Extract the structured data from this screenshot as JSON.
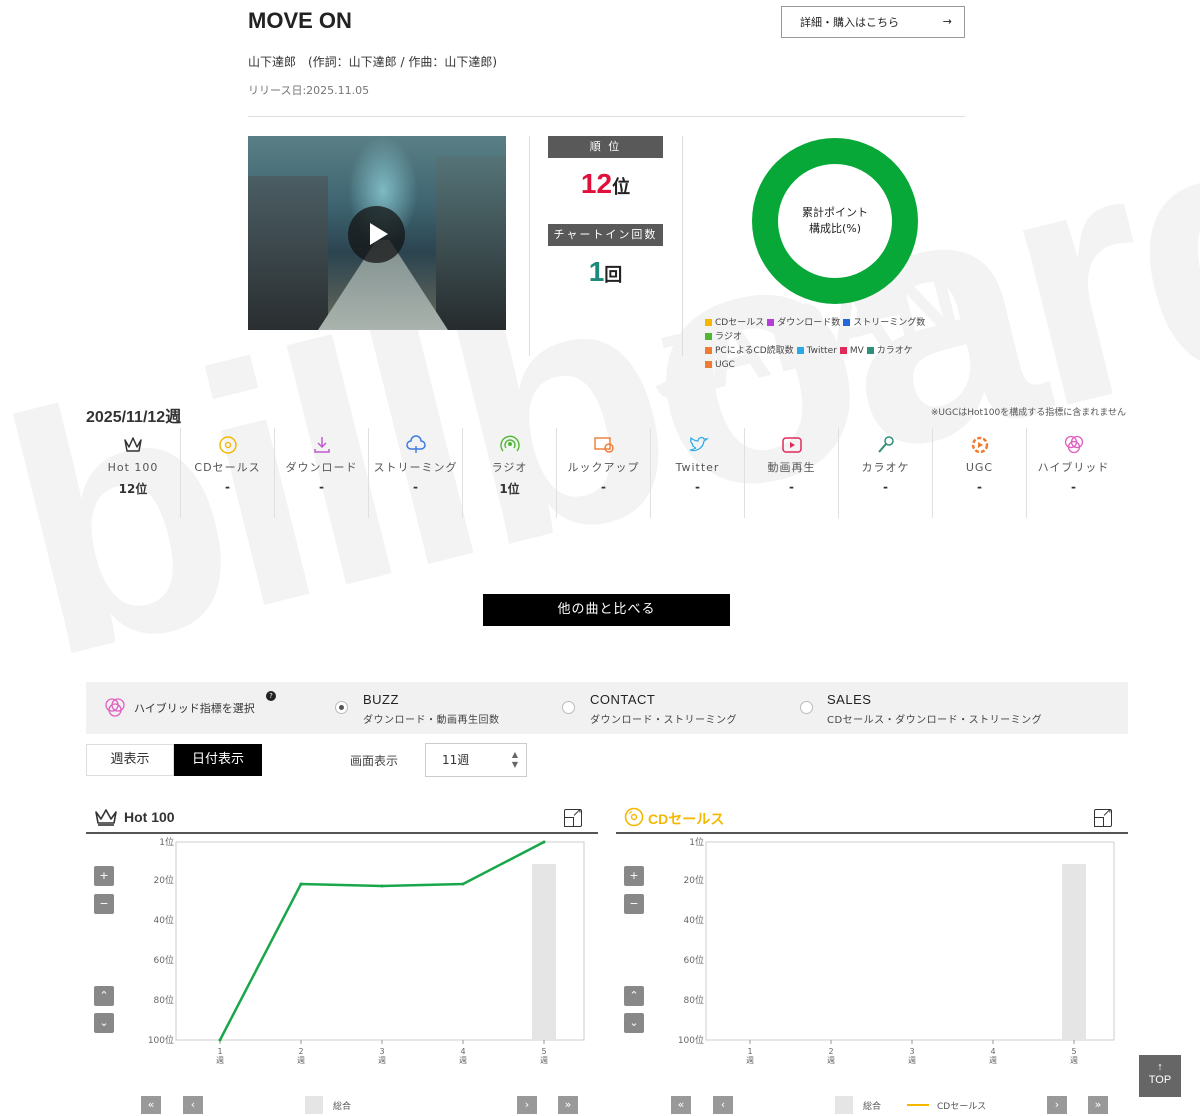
{
  "song": {
    "title": "MOVE ON",
    "artist_line": "山下達郎　(作詞：山下達郎 / 作曲：山下達郎)",
    "release": "リリース日:2025.11.05",
    "detail_button": "詳細・購入はこちら",
    "detail_arrow": "→"
  },
  "ranking": {
    "rank_label": "順 位",
    "rank_value": "12",
    "rank_unit": "位",
    "chartin_label": "チャートイン回数",
    "chartin_value": "1",
    "chartin_unit": "回"
  },
  "donut": {
    "label_line1": "累計ポイント",
    "label_line2": "構成比(%)",
    "ring_color": "#08a838",
    "legend": [
      {
        "label": "CDセールス",
        "color": "#f5b800"
      },
      {
        "label": "ダウンロード数",
        "color": "#b23fd6"
      },
      {
        "label": "ストリーミング数",
        "color": "#2266dd"
      },
      {
        "label": "ラジオ",
        "color": "#4cb832"
      },
      {
        "label": "PCによるCD読取数",
        "color": "#f07a30"
      },
      {
        "label": "Twitter",
        "color": "#2aa9e8"
      },
      {
        "label": "MV",
        "color": "#e02a5a"
      },
      {
        "label": "カラオケ",
        "color": "#2f8f7a"
      },
      {
        "label": "UGC",
        "color": "#f07a30"
      }
    ]
  },
  "week": {
    "title": "2025/11/12週",
    "ugc_note": "※UGCはHot100を構成する指標に含まれません",
    "metrics": [
      {
        "name": "Hot 100",
        "value": "12位",
        "icon": "crown-icon",
        "color": "#333333"
      },
      {
        "name": "CDセールス",
        "value": "-",
        "icon": "cd-icon",
        "color": "#f5b800"
      },
      {
        "name": "ダウンロード",
        "value": "-",
        "icon": "download-icon",
        "color": "#c05ad0"
      },
      {
        "name": "ストリーミング",
        "value": "-",
        "icon": "streaming-icon",
        "color": "#3d7be0"
      },
      {
        "name": "ラジオ",
        "value": "1位",
        "icon": "radio-icon",
        "color": "#4cb832"
      },
      {
        "name": "ルックアップ",
        "value": "-",
        "icon": "lookup-icon",
        "color": "#f07a30"
      },
      {
        "name": "Twitter",
        "value": "-",
        "icon": "twitter-icon",
        "color": "#2aa9e8"
      },
      {
        "name": "動画再生",
        "value": "-",
        "icon": "video-icon",
        "color": "#e02a5a"
      },
      {
        "name": "カラオケ",
        "value": "-",
        "icon": "karaoke-icon",
        "color": "#2f8f7a"
      },
      {
        "name": "UGC",
        "value": "-",
        "icon": "ugc-icon",
        "color": "#f07a30"
      },
      {
        "name": "ハイブリッド",
        "value": "-",
        "icon": "hybrid-icon",
        "color": "#e060c0"
      }
    ],
    "compare_button": "他の曲と比べる"
  },
  "hybrid": {
    "label": "ハイブリッド指標を選択",
    "help": "?",
    "options": [
      {
        "name": "BUZZ",
        "desc": "ダウンロード・動画再生回数",
        "selected": true
      },
      {
        "name": "CONTACT",
        "desc": "ダウンロード・ストリーミング",
        "selected": false
      },
      {
        "name": "SALES",
        "desc": "CDセールス・ダウンロード・ストリーミング",
        "selected": false
      }
    ]
  },
  "view": {
    "tab_week": "週表示",
    "tab_day": "日付表示",
    "display_label": "画面表示",
    "display_value": "11週",
    "up_arrow": "▲",
    "down_arrow": "▼"
  },
  "panels": [
    {
      "title": "Hot 100",
      "icon": "crown-icon",
      "title_color": "#333333",
      "legend_total": "総合",
      "legend_series": ""
    },
    {
      "title": "CDセールス",
      "icon": "cd-icon",
      "title_color": "#f5b800",
      "legend_total": "総合",
      "legend_series": "CDセールス"
    }
  ],
  "controls": {
    "zoom_in": "+",
    "zoom_out": "−",
    "up": "⌃",
    "down": "⌄",
    "first": "«",
    "prev": "‹",
    "next": "›",
    "last": "»"
  },
  "chart_data": [
    {
      "type": "line",
      "title": "Hot 100",
      "categories": [
        "1週",
        "2週",
        "3週",
        "4週",
        "5週"
      ],
      "y_ticks": [
        "1位",
        "20位",
        "40位",
        "60位",
        "80位",
        "100位"
      ],
      "ylim": [
        1,
        100
      ],
      "y_inverted": true,
      "series": [
        {
          "name": "",
          "color": "#1aa64a",
          "values": [
            100,
            22,
            23,
            22,
            1
          ]
        }
      ],
      "total_bar": {
        "name": "総合",
        "category": "5週",
        "value": 12
      }
    },
    {
      "type": "line",
      "title": "CDセールス",
      "categories": [
        "1週",
        "2週",
        "3週",
        "4週",
        "5週"
      ],
      "y_ticks": [
        "1位",
        "20位",
        "40位",
        "60位",
        "80位",
        "100位"
      ],
      "ylim": [
        1,
        100
      ],
      "y_inverted": true,
      "series": [
        {
          "name": "CDセールス",
          "color": "#f5b800",
          "values": []
        }
      ],
      "total_bar": {
        "name": "総合",
        "category": "5週",
        "value": 12
      }
    }
  ],
  "top_button": {
    "arrow": "↑",
    "label": "TOP"
  }
}
